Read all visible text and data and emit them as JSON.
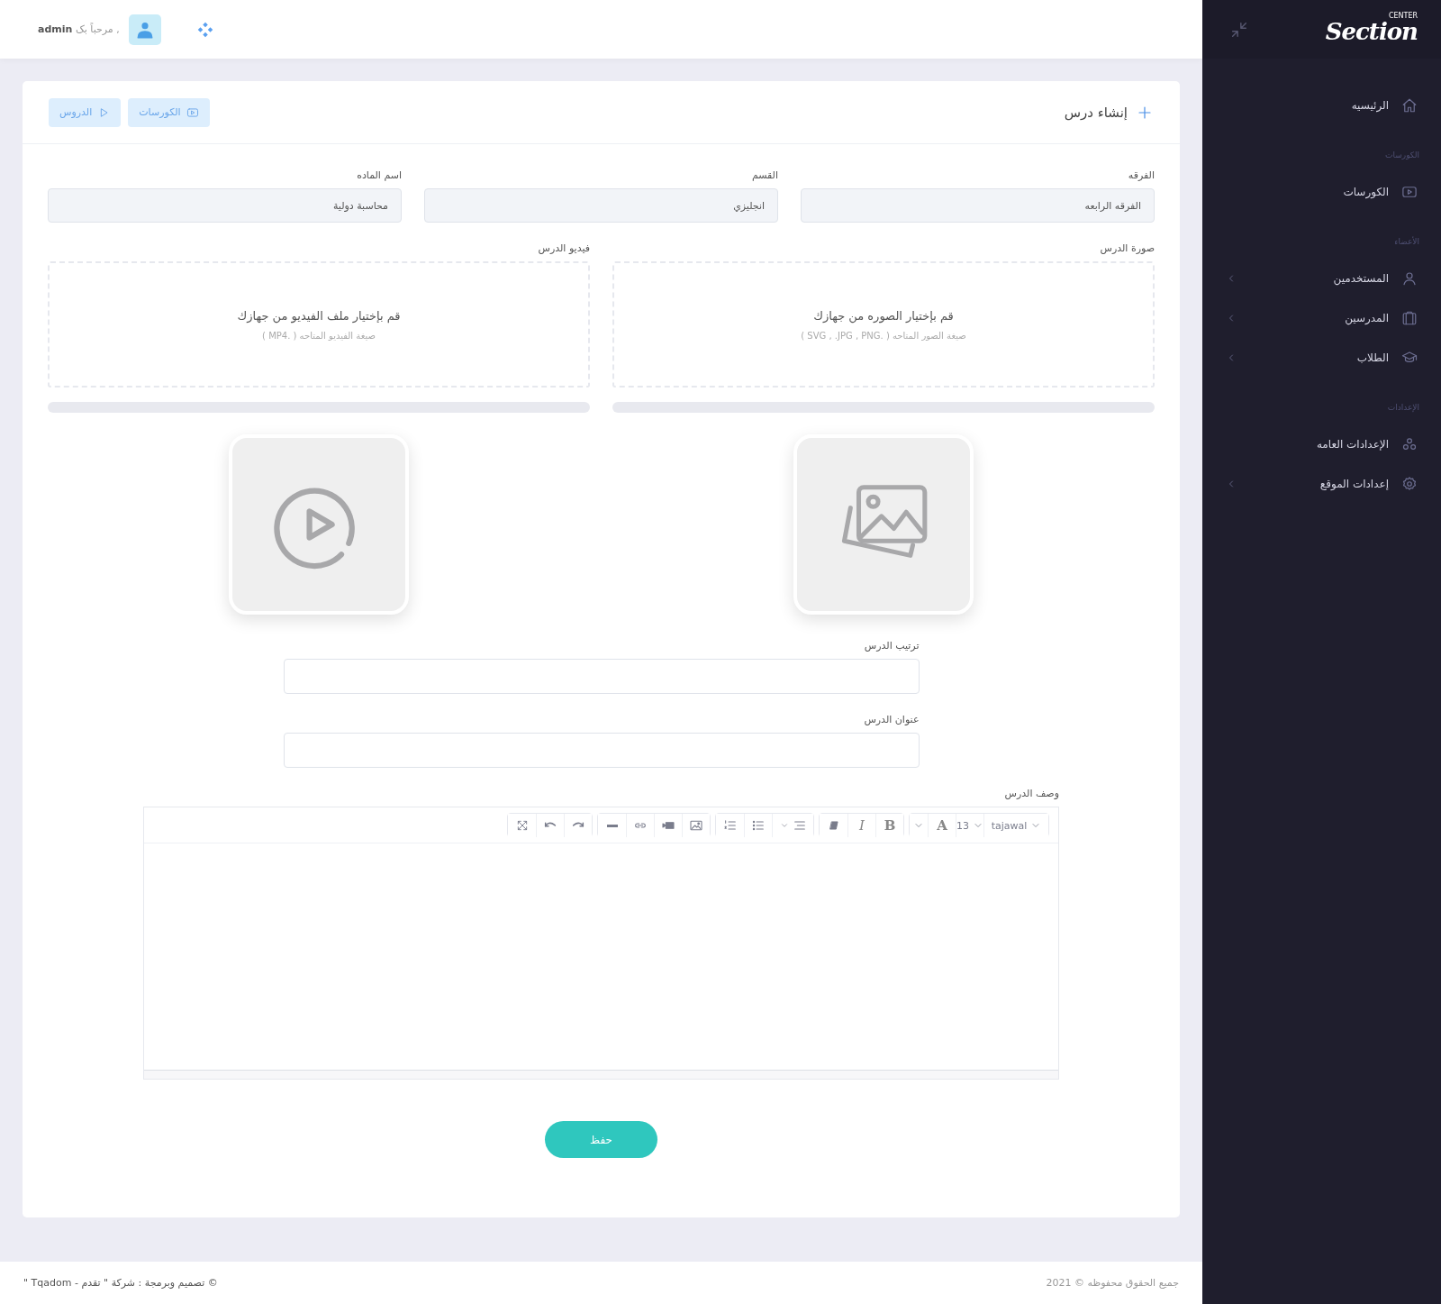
{
  "topbar": {
    "greeting": "مرحباً بک ,",
    "user": "admin"
  },
  "sidebar": {
    "logo": {
      "text": "Section",
      "badge": "CENTER"
    },
    "items": [
      {
        "kind": "link",
        "label": "الرئيسيه",
        "has_submenu": false
      },
      {
        "kind": "heading",
        "label": "الكورسات"
      },
      {
        "kind": "link",
        "label": "الكورسات",
        "has_submenu": false
      },
      {
        "kind": "heading",
        "label": "الأعضاء"
      },
      {
        "kind": "link",
        "label": "المستخدمين",
        "has_submenu": true
      },
      {
        "kind": "link",
        "label": "المدرسين",
        "has_submenu": true
      },
      {
        "kind": "link",
        "label": "الطلاب",
        "has_submenu": true
      },
      {
        "kind": "heading",
        "label": "الإعدادات"
      },
      {
        "kind": "link",
        "label": "الإعدادات العامه",
        "has_submenu": false
      },
      {
        "kind": "link",
        "label": "إعدادات الموقع",
        "has_submenu": true
      }
    ]
  },
  "page": {
    "title": "إنشاء درس",
    "nav_buttons": [
      {
        "kind": "courses",
        "label": "الكورسات"
      },
      {
        "kind": "lessons",
        "label": "الدروس"
      }
    ]
  },
  "fields": [
    {
      "label": "الفرقه",
      "value": "الفرقه الرابعه"
    },
    {
      "label": "القسم",
      "value": "انجليزي"
    },
    {
      "label": "اسم الماده",
      "value": "محاسبة دولية"
    }
  ],
  "uploads": [
    {
      "kind": "image",
      "label": "صورة الدرس",
      "prompt": "قم بإختيار الصوره من جهازك",
      "hint": "صيغة الصور المتاحه ( .SVG , .JPG , PNG )",
      "level": 0
    },
    {
      "kind": "video",
      "label": "فيديو الدرس",
      "prompt": "قم بإختيار ملف الفيديو من جهازك",
      "hint": "صيغة الفيديو المتاحه ( .MP4 )",
      "level": 0
    }
  ],
  "text_fields": [
    {
      "label": "ترتيب الدرس"
    },
    {
      "label": "عنوان الدرس"
    }
  ],
  "editor": {
    "label": "وصف الدرس",
    "font": "tajawal",
    "size": "13",
    "color_glyph": "A",
    "bold_glyph": "B",
    "italic_glyph": "I"
  },
  "save_button": "حفظ",
  "footer": {
    "copyright": "جميع الحقوق محفوظه © 2021",
    "credit": "© تصميم وبرمجة : شركة \" تقدم - Tqadom \""
  }
}
